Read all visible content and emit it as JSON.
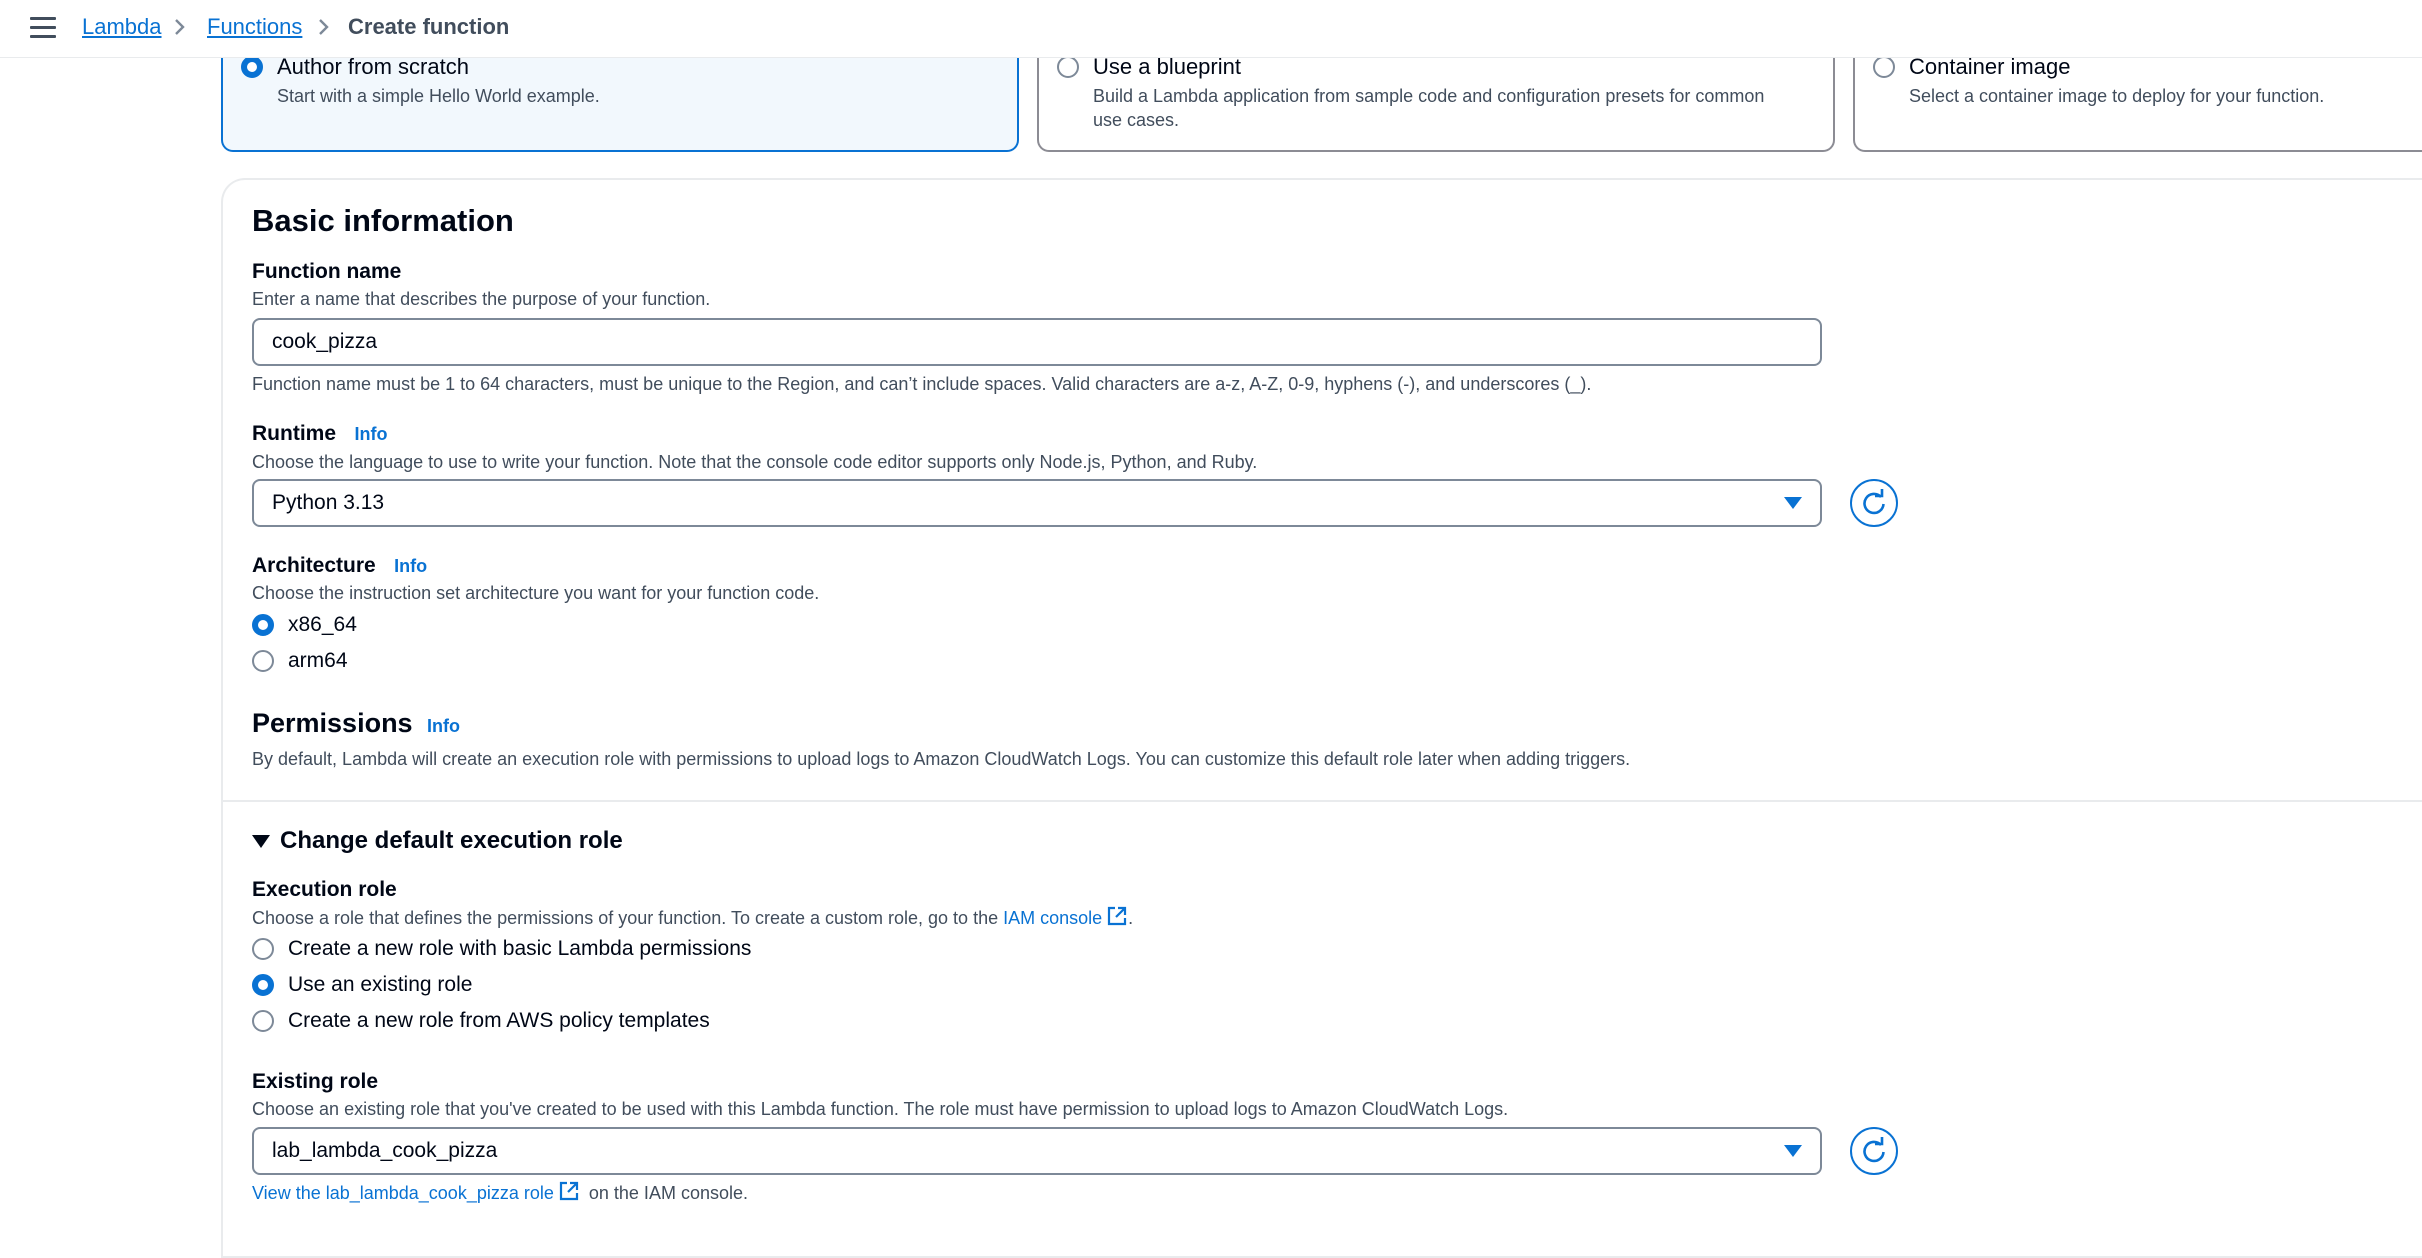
{
  "breadcrumb": {
    "items": [
      "Lambda",
      "Functions"
    ],
    "current": "Create function"
  },
  "options": [
    {
      "title": "Author from scratch",
      "desc": "Start with a simple Hello World example.",
      "selected": true
    },
    {
      "title": "Use a blueprint",
      "desc_line1": "Build a Lambda application from sample code and configuration presets for common",
      "desc_line2": "use cases.",
      "selected": false
    },
    {
      "title": "Container image",
      "desc": "Select a container image to deploy for your function.",
      "selected": false
    }
  ],
  "basic_info": {
    "heading": "Basic information",
    "function_name": {
      "label": "Function name",
      "desc": "Enter a name that describes the purpose of your function.",
      "value": "cook_pizza",
      "hint": "Function name must be 1 to 64 characters, must be unique to the Region, and can’t include spaces. Valid characters are a-z, A-Z, 0-9, hyphens (-), and underscores (_)."
    },
    "runtime": {
      "label": "Runtime",
      "info": "Info",
      "desc": "Choose the language to use to write your function. Note that the console code editor supports only Node.js, Python, and Ruby.",
      "value": "Python 3.13"
    },
    "architecture": {
      "label": "Architecture",
      "info": "Info",
      "desc": "Choose the instruction set architecture you want for your function code.",
      "options": [
        "x86_64",
        "arm64"
      ],
      "selected": "x86_64"
    },
    "permissions": {
      "heading": "Permissions",
      "info": "Info",
      "desc": "By default, Lambda will create an execution role with permissions to upload logs to Amazon CloudWatch Logs. You can customize this default role later when adding triggers."
    }
  },
  "execution_role": {
    "expander": "Change default execution role",
    "label": "Execution role",
    "desc_prefix": "Choose a role that defines the permissions of your function. To create a custom role, go to the ",
    "desc_link": "IAM console",
    "desc_suffix": ".",
    "options": [
      "Create a new role with basic Lambda permissions",
      "Use an existing role",
      "Create a new role from AWS policy templates"
    ],
    "selected": "Use an existing role"
  },
  "existing_role": {
    "label": "Existing role",
    "desc": "Choose an existing role that you've created to be used with this Lambda function. The role must have permission to upload logs to Amazon CloudWatch Logs.",
    "value": "lab_lambda_cook_pizza",
    "view_link": "View the lab_lambda_cook_pizza role",
    "view_suffix": "on the IAM console."
  },
  "colors": {
    "accent": "#0972d3",
    "text": "#000716",
    "muted": "#414d5c",
    "border": "#7d8998"
  }
}
